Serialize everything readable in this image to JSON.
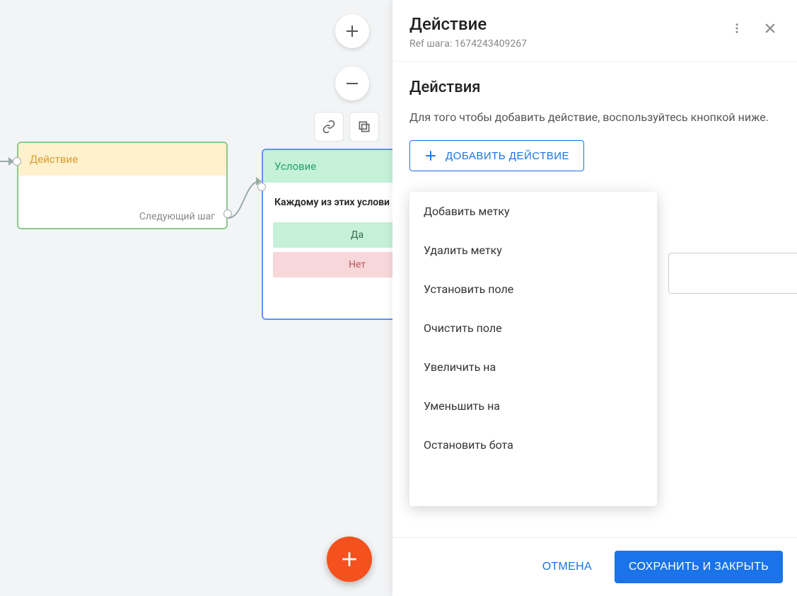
{
  "canvas": {
    "action_node": {
      "title": "Действие",
      "next_step": "Следующий шаг"
    },
    "condition_node": {
      "title": "Условие",
      "subtitle": "Каждому из этих услови",
      "yes": "Да",
      "no": "Нет"
    }
  },
  "panel": {
    "title": "Действие",
    "ref": "Ref шага: 1674243409267",
    "section_title": "Действия",
    "hint": "Для того чтобы добавить действие, воспользуйтесь кнопкой ниже.",
    "add_button": "ДОБАВИТЬ ДЕЙСТВИЕ",
    "dropdown": [
      "Добавить метку",
      "Удалить метку",
      "Установить поле",
      "Очистить поле",
      "Увеличить на",
      "Уменьшить на",
      "Остановить бота"
    ],
    "footer": {
      "cancel": "ОТМЕНА",
      "save": "СОХРАНИТЬ И ЗАКРЫТЬ"
    }
  }
}
